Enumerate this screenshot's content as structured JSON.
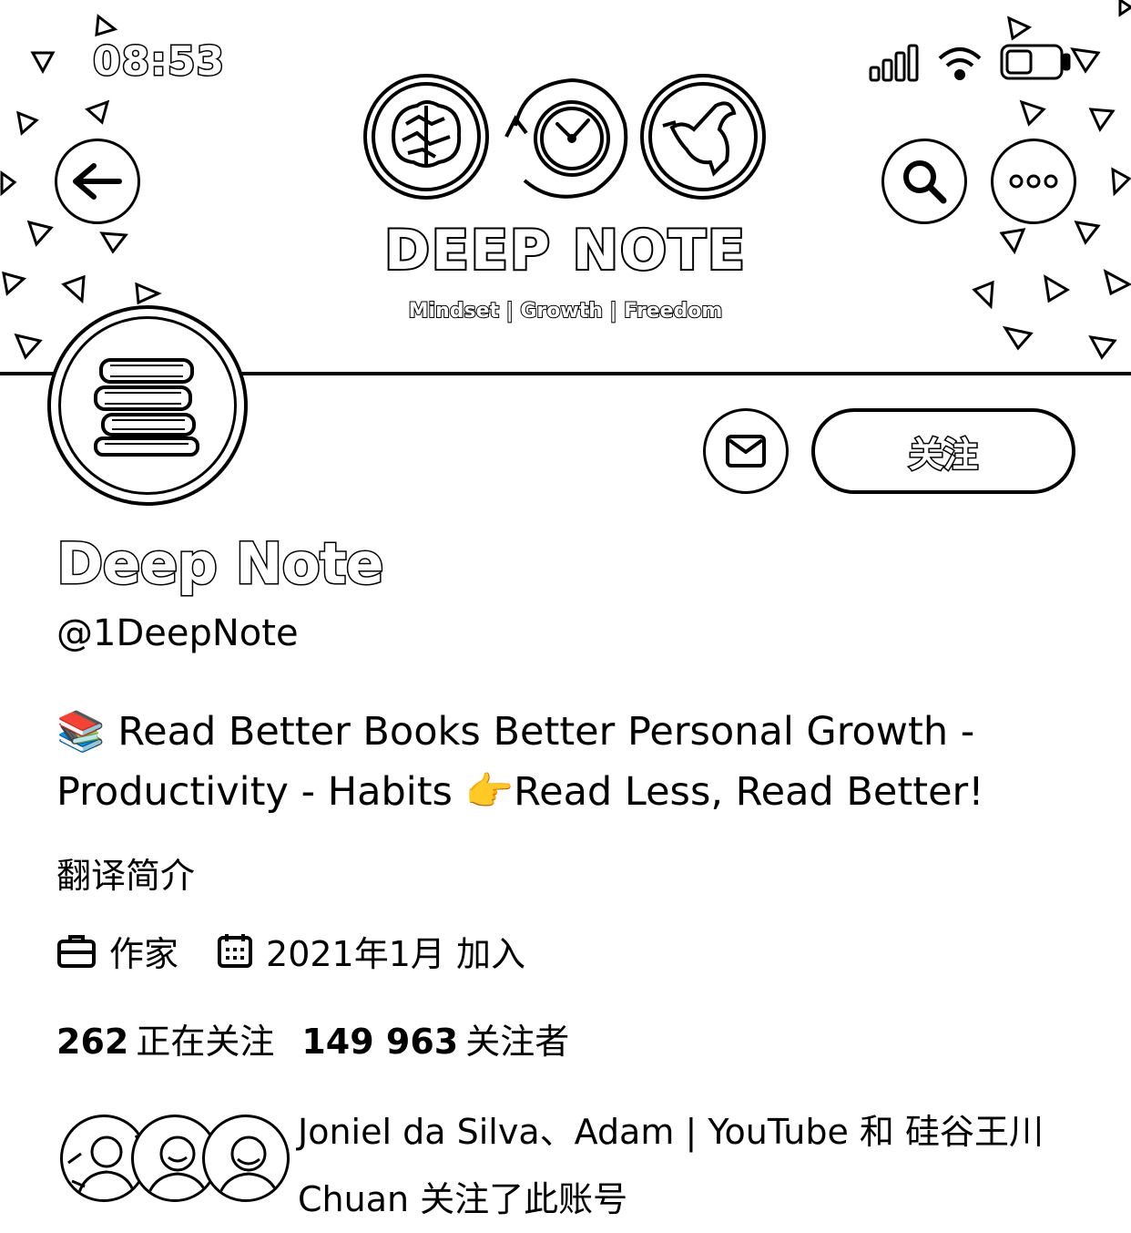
{
  "status_bar": {
    "time": "08:53"
  },
  "banner": {
    "title": "DEEP NOTE",
    "tagline": "Mindset | Growth | Freedom"
  },
  "nav": {
    "back_icon": "back-arrow-icon",
    "search_icon": "search-icon",
    "more_icon": "more-icon"
  },
  "actions": {
    "message_icon": "mail-icon",
    "follow_label": "关注"
  },
  "profile": {
    "name": "Deep Note",
    "handle": "@1DeepNote",
    "bio_emoji_1": "📚",
    "bio_line_1": "Read Better Books Better Personal Growth -",
    "bio_line_2a": "Productivity - Habits ",
    "bio_emoji_2": "👉",
    "bio_line_2b": "Read Less, Read Better!",
    "translate_label": "翻译简介",
    "category": "作家",
    "joined": "2021年1月 加入"
  },
  "counts": {
    "following_num": "262",
    "following_label": "正在关注",
    "followers_num": "149 963",
    "followers_label": "关注者"
  },
  "followed_by": {
    "line_1": "Joniel da Silva、Adam | YouTube 和 硅谷王川",
    "line_2": "Chuan 关注了此账号"
  }
}
